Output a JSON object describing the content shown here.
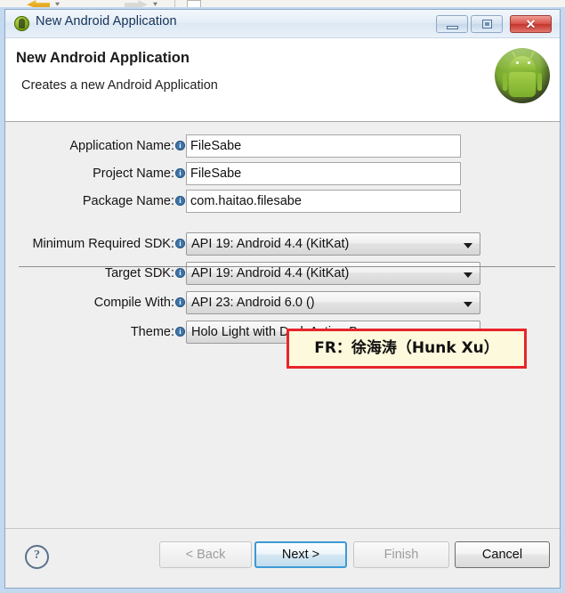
{
  "window": {
    "title": "New Android Application",
    "title_icon": "android-app-icon",
    "controls": {
      "minimize": "minimize-icon",
      "maximize": "maximize-icon",
      "close": "✕"
    }
  },
  "header": {
    "title": "New Android Application",
    "subtitle": "Creates a new Android Application",
    "logo": "android-robot-logo"
  },
  "form": {
    "info_icon": "i",
    "text_fields": [
      {
        "label": "Application Name:",
        "value": "FileSabe"
      },
      {
        "label": "Project Name:",
        "value": "FileSabe"
      },
      {
        "label": "Package Name:",
        "value": "com.haitao.filesabe"
      }
    ],
    "dropdowns": [
      {
        "label": "Minimum Required SDK:",
        "value": "API 19: Android 4.4 (KitKat)"
      },
      {
        "label": "Target SDK:",
        "value": "API 19: Android 4.4 (KitKat)"
      },
      {
        "label": "Compile With:",
        "value": "API 23: Android 6.0 ()"
      },
      {
        "label": "Theme:",
        "value": "Holo Light with Dark Action Bar"
      }
    ]
  },
  "annotation": {
    "text": "FR：徐海涛（Hunk Xu）",
    "border_color": "#e8252a",
    "fill_color": "#fdf9dc"
  },
  "footer": {
    "help_icon": "?",
    "buttons": [
      {
        "label": "< Back",
        "state": "disabled"
      },
      {
        "label": "Next >",
        "state": "focused"
      },
      {
        "label": "Finish",
        "state": "disabled"
      },
      {
        "label": "Cancel",
        "state": "enabled"
      }
    ]
  }
}
